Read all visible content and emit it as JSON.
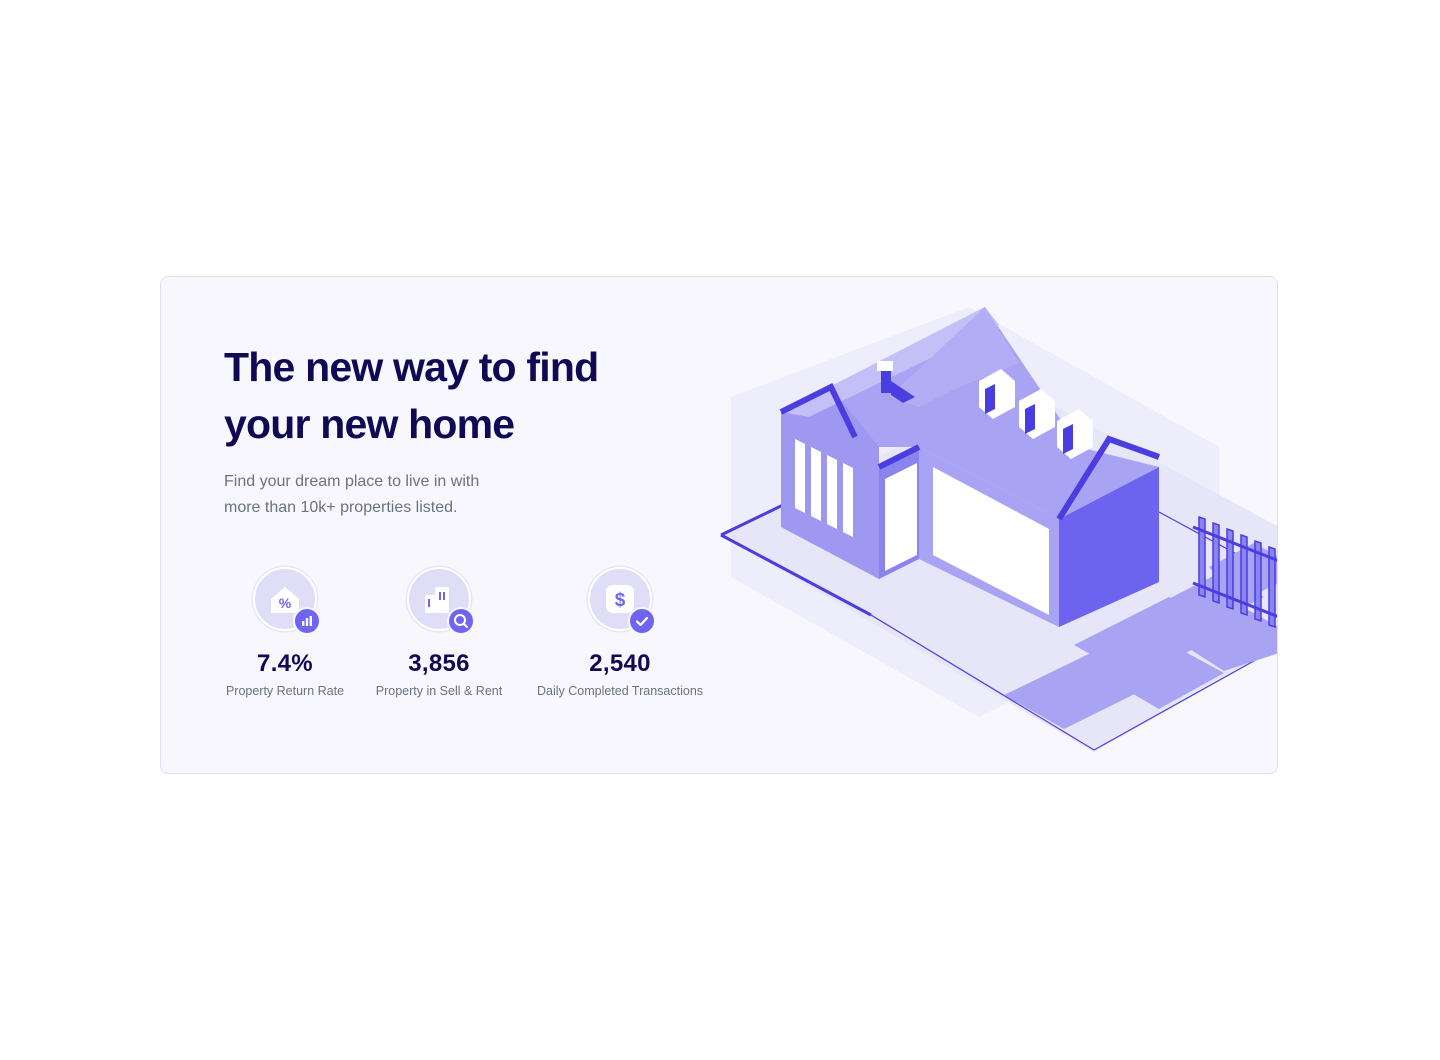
{
  "hero": {
    "headline_line1": "The new way to find",
    "headline_line2": "your new home",
    "subtitle_line1": "Find your dream place to live in with",
    "subtitle_line2": "more than 10k+ properties listed."
  },
  "stats": [
    {
      "value": "7.4%",
      "label": "Property Return Rate",
      "icon": "percent-house-icon",
      "badge_icon": "bar-chart-icon"
    },
    {
      "value": "3,856",
      "label": "Property in Sell & Rent",
      "icon": "buildings-icon",
      "badge_icon": "search-icon"
    },
    {
      "value": "2,540",
      "label": "Daily Completed Transactions",
      "icon": "dollar-icon",
      "badge_icon": "check-icon"
    }
  ],
  "illustration": {
    "icon": "isometric-house-illustration"
  },
  "colors": {
    "primary": "#7065f0",
    "heading": "#100a55",
    "muted_text": "#6c727f",
    "card_background": "#f7f7fd",
    "card_border": "#e0def7"
  }
}
